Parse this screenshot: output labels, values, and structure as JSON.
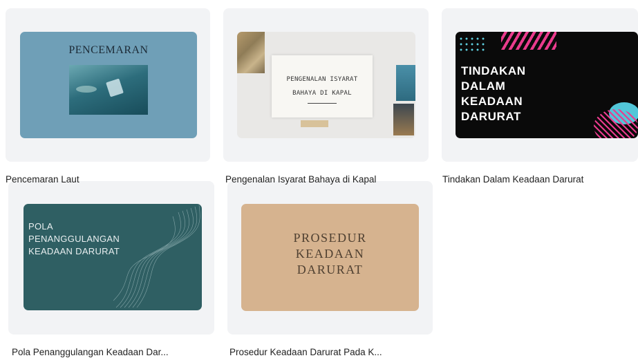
{
  "designs": [
    {
      "caption": "Pencemaran Laut",
      "thumb_lines": [
        "PENCEMARAN"
      ],
      "thumb_bg": "#6f9fb7"
    },
    {
      "caption": "Pengenalan Isyarat Bahaya di Kapal",
      "thumb_lines": [
        "PENGENALAN ISYARAT",
        "BAHAYA DI KAPAL"
      ],
      "thumb_bg": "#e9e8e6"
    },
    {
      "caption": "Tindakan Dalam Keadaan Darurat",
      "thumb_lines": [
        "TINDAKAN",
        "DALAM",
        "KEADAAN",
        "DARURAT"
      ],
      "thumb_bg": "#0a0a0a"
    },
    {
      "caption": "Pola Penanggulangan Keadaan Dar...",
      "thumb_lines": [
        "POLA",
        "PENANGGULANGAN",
        "KEADAAN DARURAT"
      ],
      "thumb_bg": "#2f5f63"
    },
    {
      "caption": "Prosedur Keadaan Darurat Pada K...",
      "thumb_lines": [
        "PROSEDUR",
        "KEADAAN",
        "DARURAT"
      ],
      "thumb_bg": "#d6b38f"
    }
  ]
}
